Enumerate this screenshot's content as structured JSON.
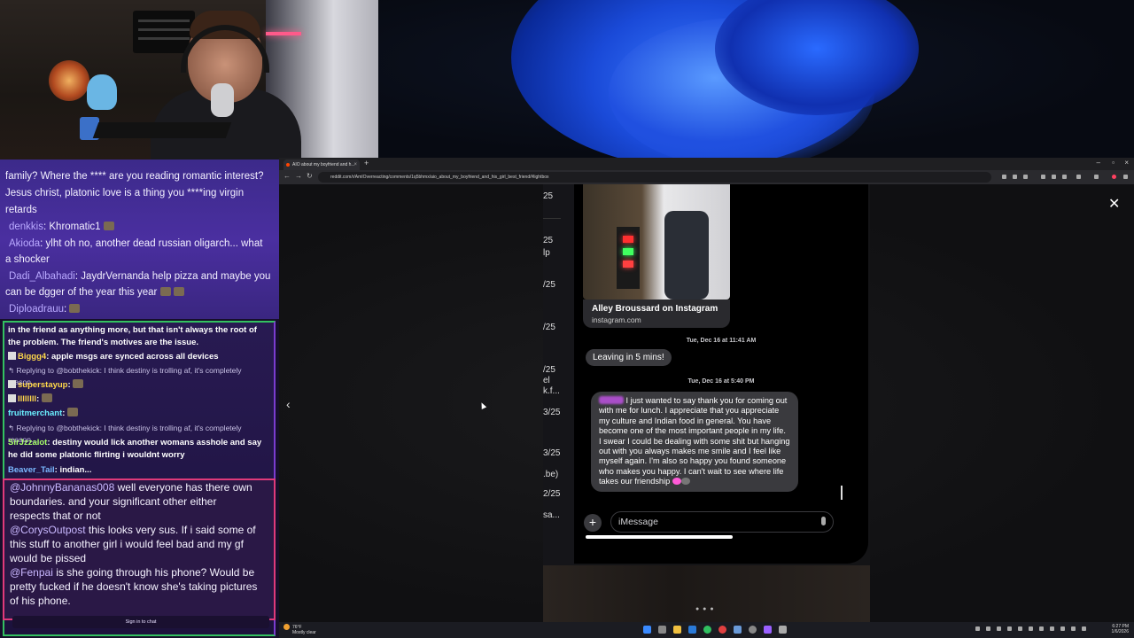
{
  "colors": {
    "chat_top_bg": "#4a2fa0",
    "chat_mid_border": "#33c160",
    "chat_low_border": "#e03a7a",
    "bubble_bg": "#3a3a3e",
    "accent_reddit": "#ff4500"
  },
  "chat_top": {
    "lines": [
      "family? Where the **** are you reading romantic interest?",
      "Jesus christ, platonic love is a thing you ****ing virgin",
      "retards"
    ],
    "msg1_user": "denkkis",
    "msg1_text": ": Khromatic1",
    "msg2_user": "Akioda",
    "msg2_text": ": ylht oh no, another dead russian oligarch... what",
    "msg2_cont": "a shocker",
    "msg3_user": "Dadi_Albahadi",
    "msg3_text": ": JaydrVernanda help pizza and maybe you",
    "msg3_cont": "can be dgger of the year this year",
    "msg4_user": "Diploadrauu",
    "msg4_text": ":"
  },
  "chat_mid": {
    "line1": "in the friend as anything more, but that isn't always the root of",
    "line2": "the problem. The friend's motives are the issue.",
    "u1": "Biggg4",
    "t1": ": apple msgs are synced across all devices",
    "reply1": "Replying to @bobthekick: I think destiny is trolling af, it's completely reason...",
    "u2": "superstayup",
    "t2": ":",
    "u3": "llllllll",
    "t3": ":",
    "u4": "fruitmerchant",
    "t4": ":",
    "reply2": "Replying to @bobthekick: I think destiny is trolling af, it's completely reason...",
    "u5": "SirJzzalot",
    "t5": ": destiny would lick another womans asshole and say",
    "t5b": "he did some platonic flirting i wouldnt worry",
    "u6": "Beaver_Tail",
    "t6": ": indian..."
  },
  "chat_low": {
    "l1_user": "@JohnnyBananas008",
    "l1_text": " well everyone has there own",
    "l2": "boundaries. and your significant other either",
    "l3": "respects that or not",
    "l4_user": "@CorysOutpost",
    "l4_text": " this looks very sus. If i said some of",
    "l5": "this stuff to another girl i would feel bad and my gf",
    "l6": "would be pissed",
    "l7_user": "@Fenpai",
    "l7_text": " is she going through his phone? Would be",
    "l8": "pretty fucked if he doesn't know she's taking pictures",
    "l9": "of his phone.",
    "signin": "Sign in to chat"
  },
  "browser": {
    "tab_title": "AIO about my boyfriend and h...",
    "url": "reddit.com/r/AmIOverreacting/comments/1q5bhmx/aio_about_my_boyfriend_and_his_girl_best_friend/#lightbox"
  },
  "phone": {
    "side_dates": [
      "25",
      "25",
      "lp",
      "/25",
      "/25",
      "/25",
      "el",
      "k.f...",
      "3/25",
      "3/25",
      ".be)",
      "2/25",
      "sa..."
    ],
    "insta_title": "Alley Broussard on Instagram",
    "insta_sub": "instagram.com",
    "ts1": "Tue, Dec 16 at 11:41 AM",
    "bubble1": "Leaving in 5 mins!",
    "ts2": "Tue, Dec 16 at 5:40 PM",
    "bubble2": " I just wanted to say thank you for coming out with me for lunch. I appreciate that you appreciate my culture and Indian food in general. You have become one of the most important people in my life. I swear I could be dealing with some shit but hanging out with you always makes me smile and I feel like myself again. I'm also so happy you found someone who makes you happy. I can't wait to see where life takes our friendship ",
    "imessage_placeholder": "iMessage",
    "plus": "+"
  },
  "taskbar": {
    "temp": "76°F",
    "weather": "Mostly clear",
    "time": "6:27 PM",
    "date": "1/6/2026"
  },
  "icons": [
    "search-icon",
    "close-icon",
    "chevron-left-icon",
    "plus-icon",
    "mic-icon",
    "windows-start-icon"
  ]
}
